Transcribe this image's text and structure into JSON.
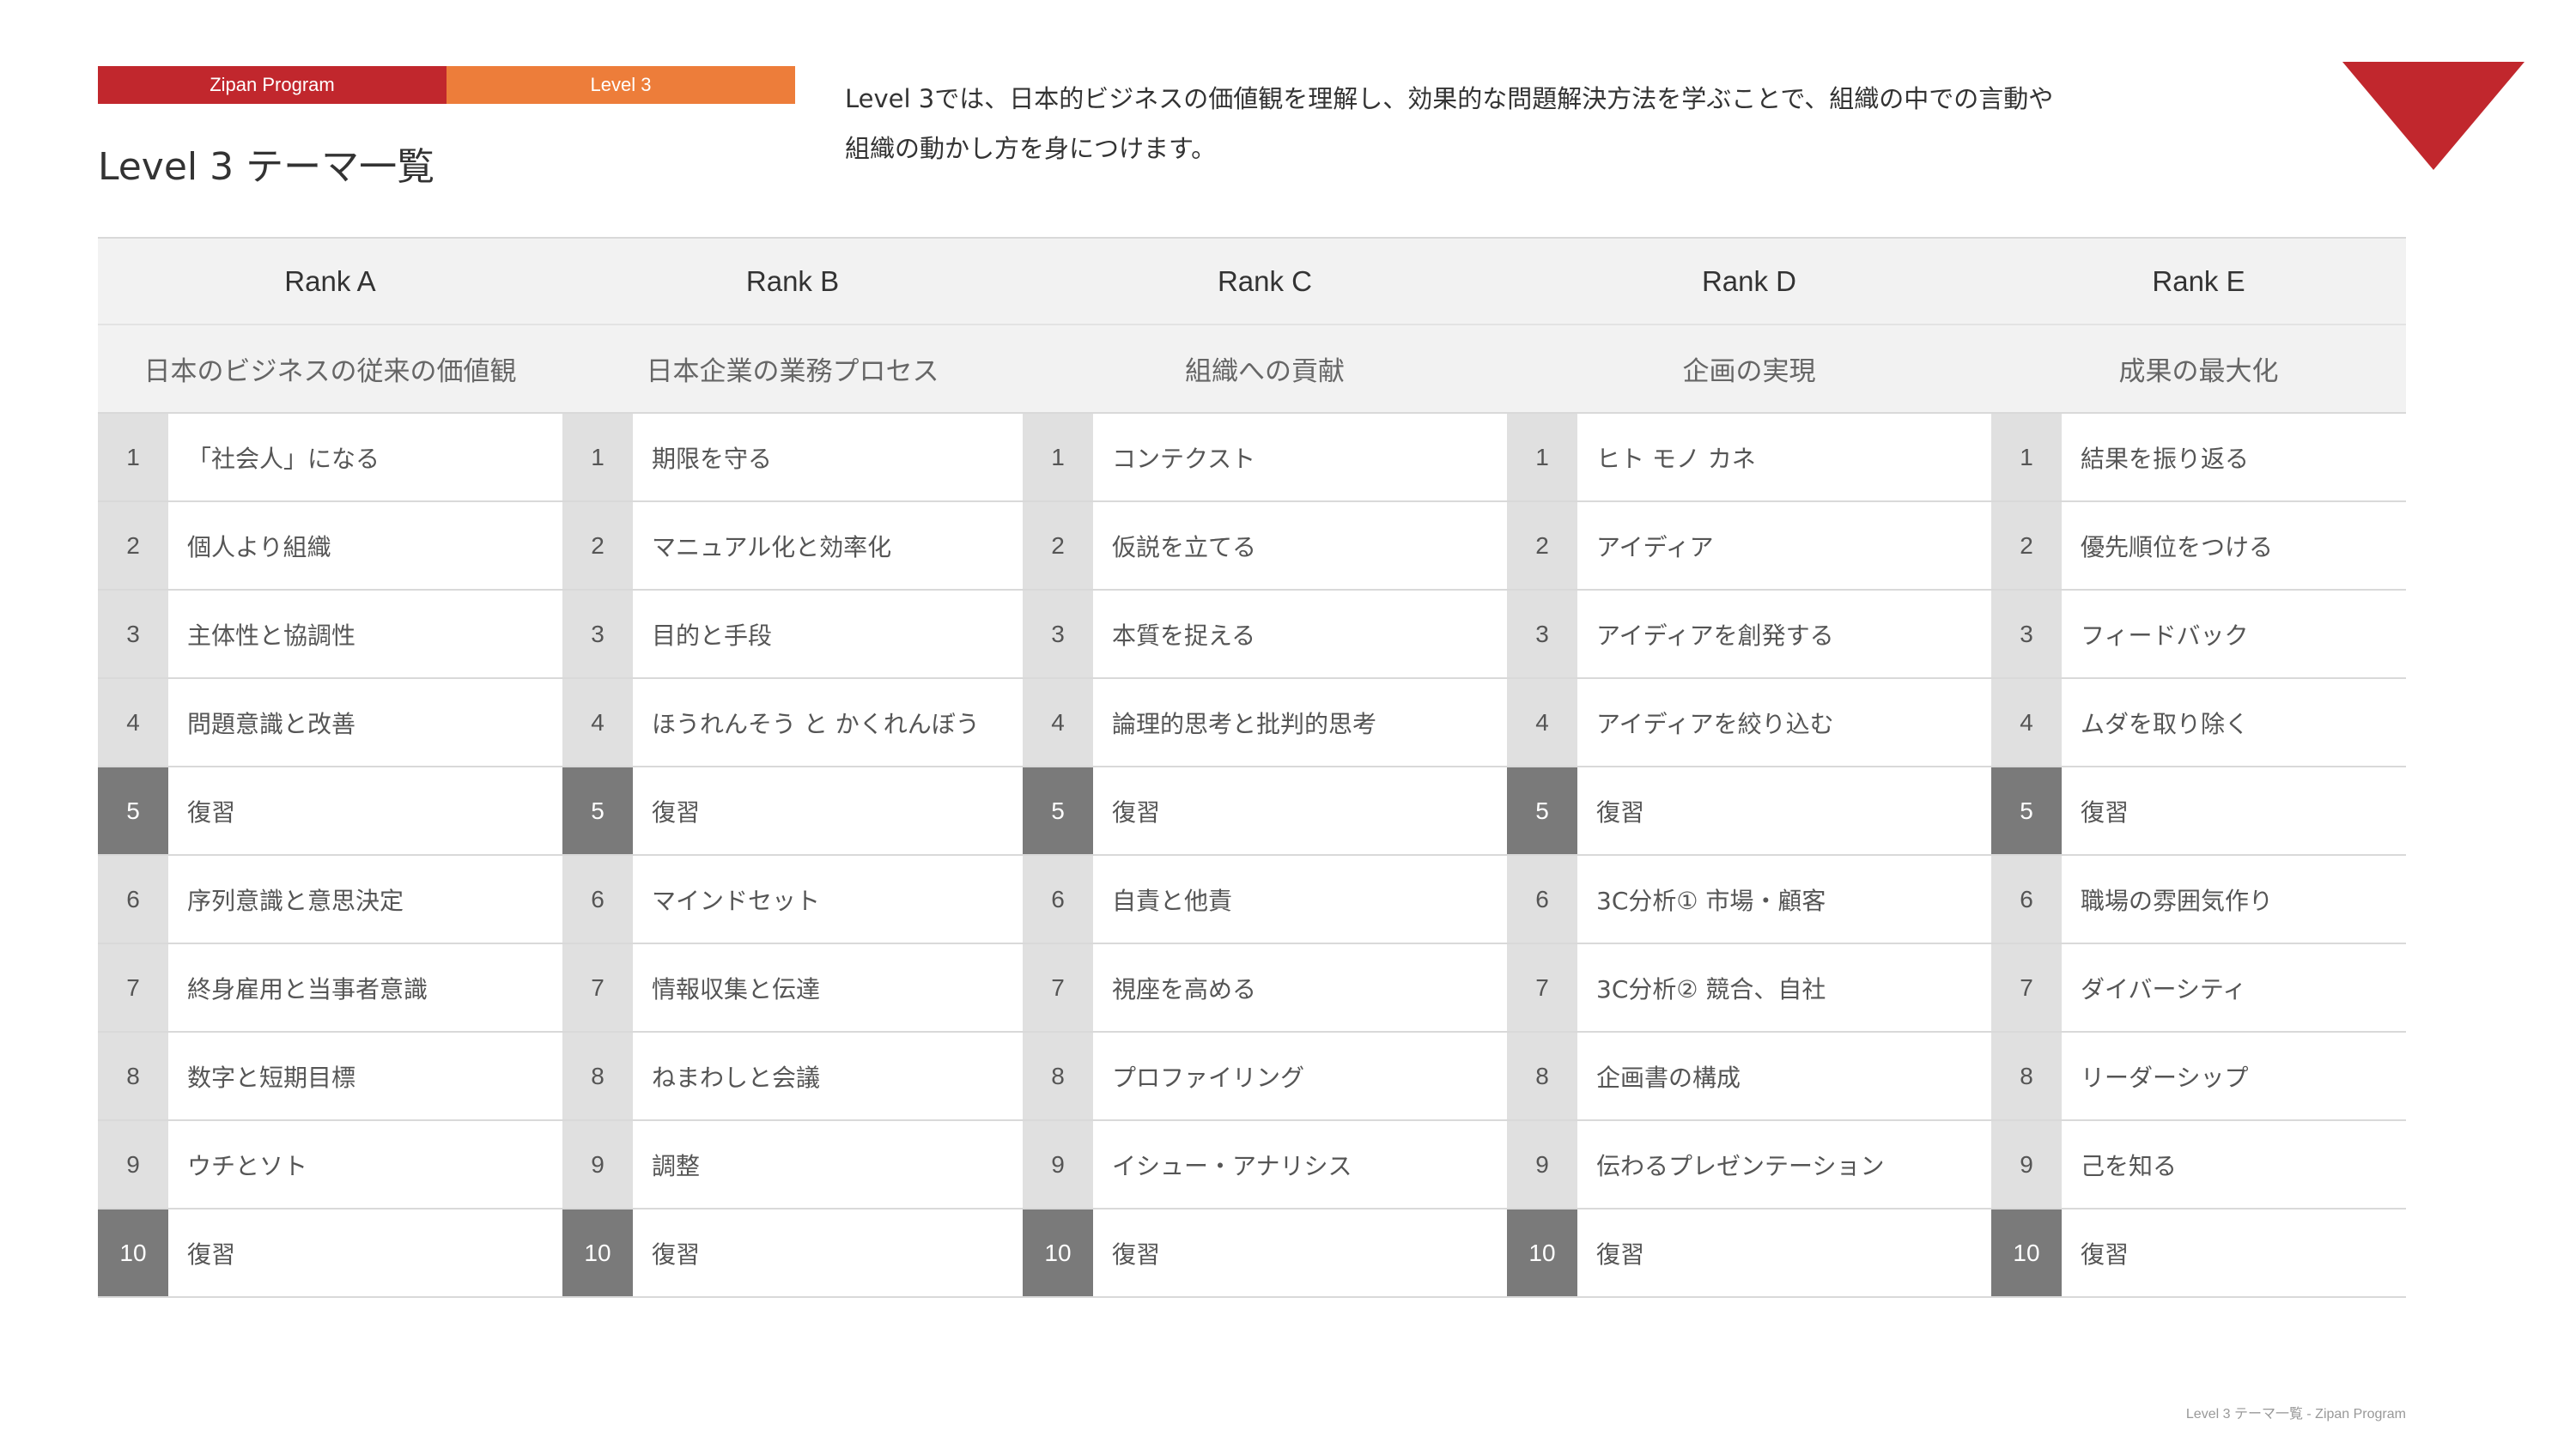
{
  "header": {
    "program_tag": "Zipan Program",
    "level_tag": "Level 3",
    "title": "Level 3 テーマ一覧",
    "intro_line1": "Level 3では、日本的ビジネスの価値観を理解し、効果的な問題解決方法を学ぶことで、組織の中での言動や",
    "intro_line2": "組織の動かし方を身につけます。"
  },
  "colors": {
    "brand_red": "#c1272d",
    "brand_orange": "#ed7d3a",
    "review_cell": "#7a7a7a",
    "number_cell": "#e0e0e0",
    "header_bg": "#f2f2f2"
  },
  "columns": [
    {
      "rank": "Rank A",
      "theme": "日本のビジネスの従来の価値観",
      "items": [
        {
          "no": "1",
          "label": "「社会人」になる"
        },
        {
          "no": "2",
          "label": "個人より組織"
        },
        {
          "no": "3",
          "label": "主体性と協調性"
        },
        {
          "no": "4",
          "label": "問題意識と改善"
        },
        {
          "no": "5",
          "label": "復習"
        },
        {
          "no": "6",
          "label": "序列意識と意思決定"
        },
        {
          "no": "7",
          "label": "終身雇用と当事者意識"
        },
        {
          "no": "8",
          "label": "数字と短期目標"
        },
        {
          "no": "9",
          "label": "ウチとソト"
        },
        {
          "no": "10",
          "label": "復習"
        }
      ]
    },
    {
      "rank": "Rank B",
      "theme": "日本企業の業務プロセス",
      "items": [
        {
          "no": "1",
          "label": "期限を守る"
        },
        {
          "no": "2",
          "label": "マニュアル化と効率化"
        },
        {
          "no": "3",
          "label": "目的と手段"
        },
        {
          "no": "4",
          "label": "ほうれんそう と かくれんぼう"
        },
        {
          "no": "5",
          "label": "復習"
        },
        {
          "no": "6",
          "label": "マインドセット"
        },
        {
          "no": "7",
          "label": "情報収集と伝達"
        },
        {
          "no": "8",
          "label": "ねまわしと会議"
        },
        {
          "no": "9",
          "label": "調整"
        },
        {
          "no": "10",
          "label": "復習"
        }
      ]
    },
    {
      "rank": "Rank C",
      "theme": "組織への貢献",
      "items": [
        {
          "no": "1",
          "label": "コンテクスト"
        },
        {
          "no": "2",
          "label": "仮説を立てる"
        },
        {
          "no": "3",
          "label": "本質を捉える"
        },
        {
          "no": "4",
          "label": "論理的思考と批判的思考"
        },
        {
          "no": "5",
          "label": "復習"
        },
        {
          "no": "6",
          "label": "自責と他責"
        },
        {
          "no": "7",
          "label": "視座を高める"
        },
        {
          "no": "8",
          "label": "プロファイリング"
        },
        {
          "no": "9",
          "label": "イシュー・アナリシス"
        },
        {
          "no": "10",
          "label": "復習"
        }
      ]
    },
    {
      "rank": "Rank D",
      "theme": "企画の実現",
      "items": [
        {
          "no": "1",
          "label": "ヒト モノ カネ"
        },
        {
          "no": "2",
          "label": "アイディア"
        },
        {
          "no": "3",
          "label": "アイディアを創発する"
        },
        {
          "no": "4",
          "label": "アイディアを絞り込む"
        },
        {
          "no": "5",
          "label": "復習"
        },
        {
          "no": "6",
          "label": "3C分析① 市場・顧客"
        },
        {
          "no": "7",
          "label": "3C分析② 競合、自社"
        },
        {
          "no": "8",
          "label": "企画書の構成"
        },
        {
          "no": "9",
          "label": "伝わるプレゼンテーション"
        },
        {
          "no": "10",
          "label": "復習"
        }
      ]
    },
    {
      "rank": "Rank E",
      "theme": "成果の最大化",
      "items": [
        {
          "no": "1",
          "label": "結果を振り返る"
        },
        {
          "no": "2",
          "label": "優先順位をつける"
        },
        {
          "no": "3",
          "label": "フィードバック"
        },
        {
          "no": "4",
          "label": "ムダを取り除く"
        },
        {
          "no": "5",
          "label": "復習"
        },
        {
          "no": "6",
          "label": "職場の雰囲気作り"
        },
        {
          "no": "7",
          "label": "ダイバーシティ"
        },
        {
          "no": "8",
          "label": "リーダーシップ"
        },
        {
          "no": "9",
          "label": "己を知る"
        },
        {
          "no": "10",
          "label": "復習"
        }
      ]
    }
  ],
  "footer": {
    "text": "Level 3 テーマ一覧 - Zipan Program"
  }
}
